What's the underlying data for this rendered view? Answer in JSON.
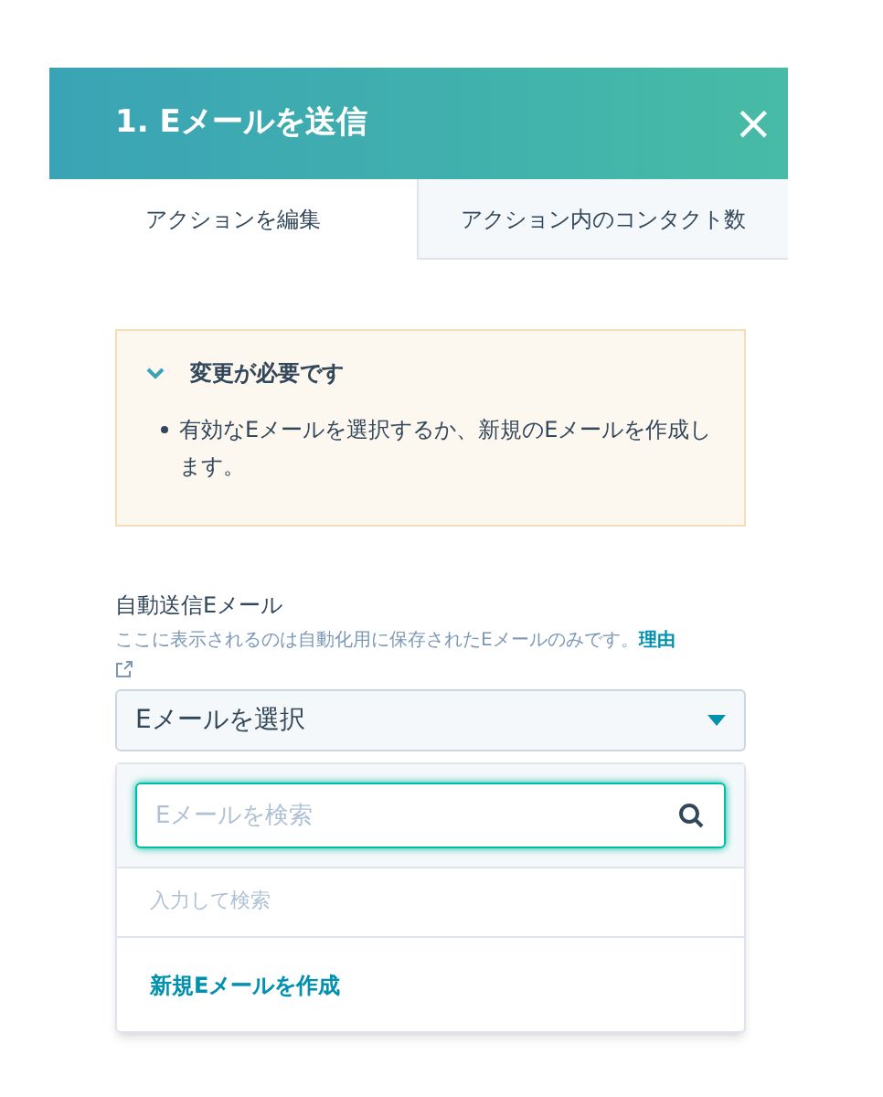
{
  "panel": {
    "title": "1. Eメールを送信",
    "close": "×"
  },
  "tabs": [
    {
      "label": "アクションを編集",
      "selected": true
    },
    {
      "label": "アクション内のコンタクト数",
      "selected": false
    }
  ],
  "alert": {
    "title": "変更が必要です",
    "expanded": true,
    "items": [
      "有効なEメールを選択するか、新規のEメールを作成します。"
    ]
  },
  "field": {
    "label": "自動送信Eメール",
    "help": "ここに表示されるのは自動化用に保存されたEメールのみです。",
    "help_link": "理由",
    "select_value": "Eメールを選択"
  },
  "dropdown": {
    "search_placeholder": "Eメールを検索",
    "hint": "入力して検索",
    "create_link": "新規Eメールを作成"
  }
}
